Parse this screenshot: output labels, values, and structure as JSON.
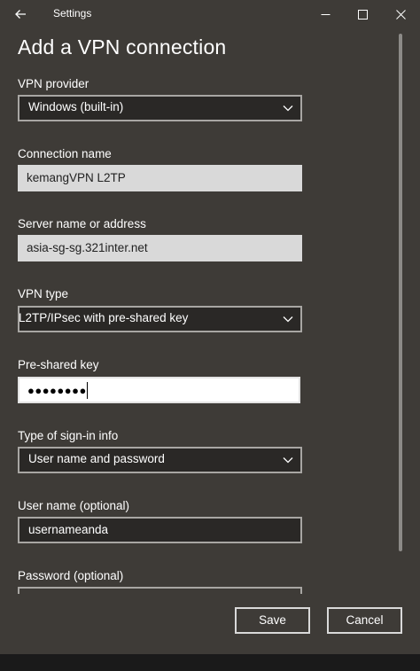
{
  "window": {
    "title": "Settings"
  },
  "page": {
    "heading": "Add a VPN connection"
  },
  "fields": {
    "vpn_provider": {
      "label": "VPN provider",
      "value": "Windows (built-in)"
    },
    "connection_name": {
      "label": "Connection name",
      "value": "kemangVPN L2TP"
    },
    "server": {
      "label": "Server name or address",
      "value": "asia-sg-sg.321inter.net"
    },
    "vpn_type": {
      "label": "VPN type",
      "value": "L2TP/IPsec with pre-shared key"
    },
    "psk": {
      "label": "Pre-shared key",
      "masked": "●●●●●●●●"
    },
    "signin_type": {
      "label": "Type of sign-in info",
      "value": "User name and password"
    },
    "username": {
      "label": "User name (optional)",
      "value": "usernameanda"
    },
    "password": {
      "label": "Password (optional)"
    }
  },
  "buttons": {
    "save": "Save",
    "cancel": "Cancel"
  },
  "icons": {
    "back": "back-arrow-icon",
    "minimize": "minimize-icon",
    "maximize": "maximize-icon",
    "close": "close-icon",
    "dropdown": "chevron-down-icon"
  },
  "colors": {
    "window_bg": "#3e3b37",
    "input_border": "#a8a6a3",
    "readonly_input_bg": "#d9d9d9",
    "text": "#ffffff"
  }
}
